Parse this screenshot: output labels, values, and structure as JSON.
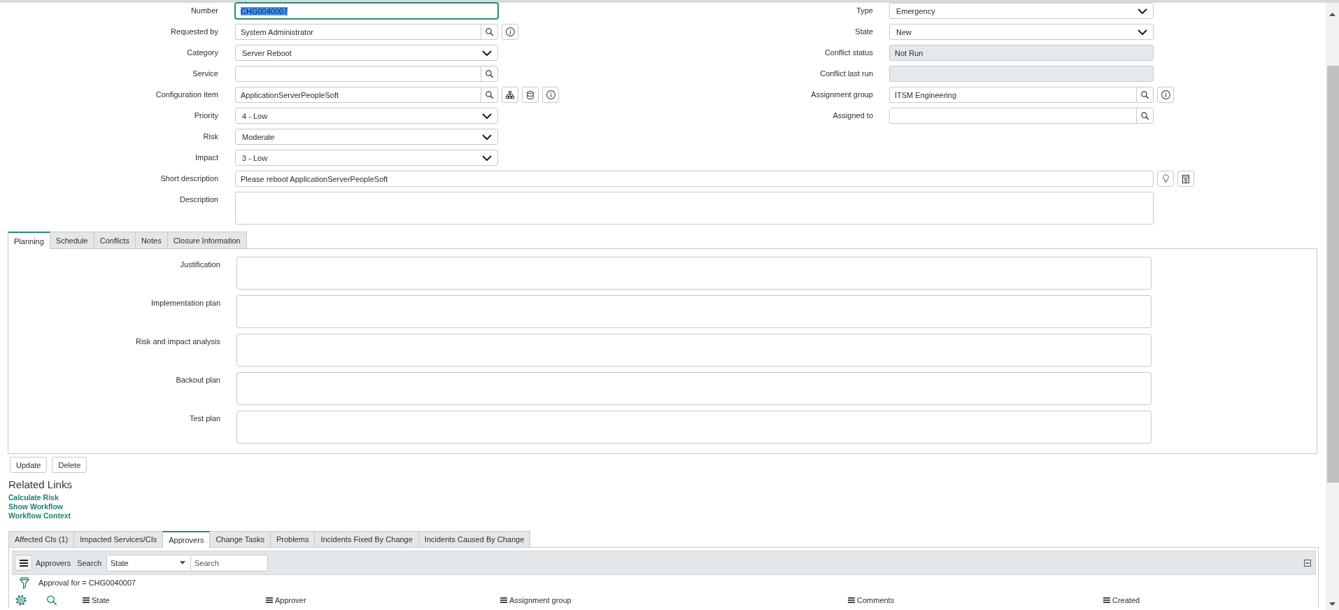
{
  "form": {
    "left": [
      {
        "label": "Number",
        "kind": "text",
        "value": "CHG0040007",
        "focused": true
      },
      {
        "label": "Requested by",
        "kind": "reference",
        "value": "System Administrator",
        "focused": false,
        "actions": [
          {
            "kind": "info"
          }
        ]
      },
      {
        "label": "Category",
        "kind": "select",
        "value": "Server Reboot",
        "focused": false
      },
      {
        "label": "Service",
        "kind": "reference",
        "focused": false
      },
      {
        "label": "Configuration item",
        "kind": "reference",
        "value": "ApplicationServerPeopleSoft",
        "focused": false,
        "actions": [
          {
            "kind": "hierarchy"
          },
          {
            "kind": "database"
          },
          {
            "kind": "info"
          }
        ]
      },
      {
        "label": "Priority",
        "kind": "select",
        "value": "4 - Low",
        "focused": false
      },
      {
        "label": "Risk",
        "kind": "select",
        "value": "Moderate",
        "focused": false
      },
      {
        "label": "Impact",
        "kind": "select",
        "value": "3 - Low",
        "focused": false
      }
    ],
    "right": [
      {
        "label": "Type",
        "kind": "select",
        "value": "Emergency",
        "focused": false
      },
      {
        "label": "State",
        "kind": "select",
        "value": "New",
        "focused": false
      },
      {
        "label": "Conflict status",
        "kind": "readonly",
        "value": "Not Run",
        "focused": false
      },
      {
        "label": "Conflict last run",
        "kind": "readonly",
        "focused": false
      },
      {
        "label": "Assignment group",
        "kind": "reference",
        "value": "ITSM Engineering",
        "focused": false,
        "actions": [
          {
            "kind": "info"
          }
        ]
      },
      {
        "label": "Assigned to",
        "kind": "reference",
        "focused": false
      }
    ],
    "wide": [
      {
        "label": "Short description",
        "kind": "text",
        "value": "Please reboot ApplicationServerPeopleSoft",
        "focused": false,
        "actions": [
          {
            "kind": "lightbulb"
          },
          {
            "kind": "template"
          }
        ]
      },
      {
        "label": "Description",
        "kind": "textarea",
        "focused": false
      }
    ]
  },
  "form_tabs": [
    {
      "label": "Planning",
      "selected": true
    },
    {
      "label": "Schedule",
      "selected": false
    },
    {
      "label": "Conflicts",
      "selected": false
    },
    {
      "label": "Notes",
      "selected": false
    },
    {
      "label": "Closure Information",
      "selected": false
    }
  ],
  "planning_fields": [
    "Justification",
    "Implementation plan",
    "Risk and impact analysis",
    "Backout plan",
    "Test plan"
  ],
  "form_buttons": [
    "Update",
    "Delete"
  ],
  "related_links": {
    "title": "Related Links",
    "links": [
      "Calculate Risk",
      "Show Workflow",
      "Workflow Context"
    ]
  },
  "related_list": {
    "tabs": [
      {
        "label": "Affected CIs (1)",
        "selected": false
      },
      {
        "label": "Impacted Services/CIs",
        "selected": false
      },
      {
        "label": "Approvers",
        "selected": true
      },
      {
        "label": "Change Tasks",
        "selected": false
      },
      {
        "label": "Problems",
        "selected": false
      },
      {
        "label": "Incidents Fixed By Change",
        "selected": false
      },
      {
        "label": "Incidents Caused By Change",
        "selected": false
      }
    ],
    "toolbar": {
      "title": "Approvers",
      "search_label": "Search",
      "filter_field": "State",
      "search_placeholder": "Search"
    },
    "filter": "Approval for = CHG0040007",
    "columns": [
      "State",
      "Approver",
      "Assignment group",
      "Comments",
      "Created"
    ]
  }
}
